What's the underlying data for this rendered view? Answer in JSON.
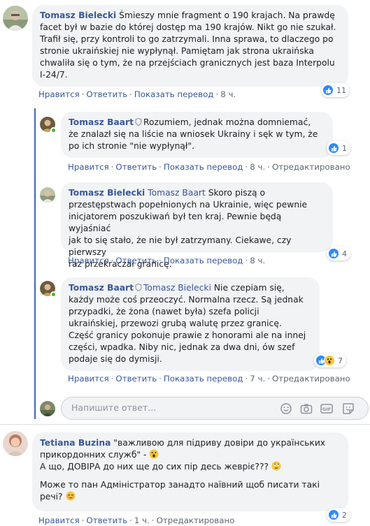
{
  "comments": [
    {
      "author": "Tomasz Bielecki",
      "lines": [
        "Śmieszy mnie fragment o 190 krajach. Na prawdę",
        "facet był w bazie do której dostęp ma 190 krajów. Nikt go nie szukał.",
        "Trafił się, przy kontroli to go zatrzymali. Inna sprawa, to dlaczego po",
        "stronie ukraińskiej nie wypłynął. Pamiętam jak strona ukraińska",
        "chwaliła się o tym, że na przejściach granicznych jest baza Interpolu",
        "I-24/7."
      ],
      "actions": {
        "like": "Нравится",
        "reply": "Ответить",
        "translate": "Показать перевод",
        "time": "8 ч."
      },
      "reaction_count": "11"
    },
    {
      "author": "Tomasz Baart",
      "first_line": "Rozumiem, jednak można domniemać,",
      "lines": [
        "że znalazł się na liście na wniosek Ukrainy i sęk w tym, że",
        "po ich stronie \"nie wypłynął\"."
      ],
      "actions": {
        "like": "Нравится",
        "reply": "Ответить",
        "translate": "Показать перевод",
        "time": "8 ч.",
        "edited": "Отредактировано"
      },
      "reaction_count": "1"
    },
    {
      "author": "Tomasz Bielecki",
      "tag": "Tomasz Baart",
      "first_line": "Skoro piszą o",
      "lines": [
        "przestępstwach popełnionych na Ukrainie, więc pewnie",
        "inicjatorem poszukiwań był ten kraj. Pewnie będą wyjaśniać",
        "jak to się stało, że nie był zatrzymany. Ciekawe, czy pierwszy",
        "raz przekraczał granicę."
      ],
      "actions": {
        "like": "Нравится",
        "reply": "Ответить",
        "translate": "Показать перевод",
        "time": "8 ч."
      },
      "reaction_count": "4"
    },
    {
      "author": "Tomasz Baart",
      "tag": "Tomasz Bielecki",
      "first_line": "Nie czepiam się,",
      "lines": [
        "każdy może coś przeoczyć. Normalna rzecz. Są jednak",
        "przypadki, że żona (nawet była) szefa policji",
        "ukraińskiej, przewozi grubą walutę przez granicę.",
        "Część granicy pokonuje prawie z honorami ale na innej",
        "części, wpadka. Niby nic, jednak za dwa dni, ów szef",
        "podaje się do dymisji."
      ],
      "actions": {
        "like": "Нравится",
        "reply": "Ответить",
        "translate": "Показать перевод",
        "time": "7 ч.",
        "edited": "Отредактировано"
      },
      "reaction_count": "7"
    },
    {
      "author": "Tetiana Buzina",
      "first_line": "\"важливою для підриву довіри до українських",
      "lines": [
        "прикордонних служб\" -",
        "А що, ДОВІРА до них ще до сих пір десь жевріє???"
      ],
      "para2": [
        "Може то пан Адміністратор занадто наївний щоб писати такі",
        "речі?"
      ],
      "actions": {
        "like": "Нравится",
        "reply": "Ответить",
        "time": "1 ч.",
        "edited": "Отредактировано"
      },
      "reaction_count": "2"
    }
  ],
  "composer": {
    "placeholder": "Напишите ответ..."
  },
  "colors": {
    "link": "#385898",
    "bubble": "#f2f3f5",
    "like": "#2e89ff",
    "thread": "#4267b2"
  }
}
